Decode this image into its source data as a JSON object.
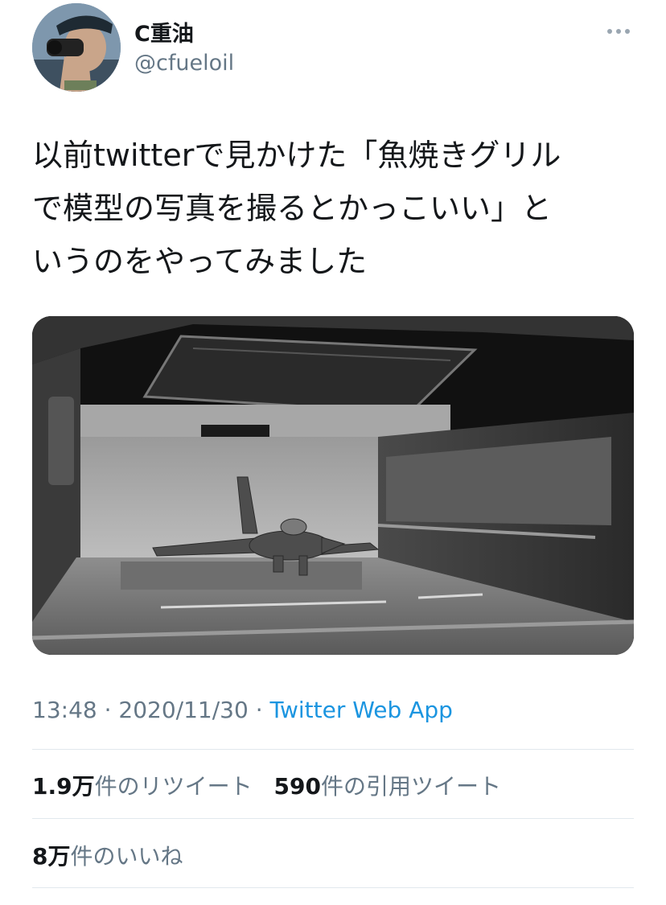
{
  "author": {
    "display_name": "C重油",
    "handle": "@cfueloil",
    "avatar_icon": "avatar-photo"
  },
  "more_icon": "more-dots-icon",
  "tweet": {
    "text_lines": [
      "以前twitterで見かけた「魚焼きグリル",
      "で模型の写真を撮るとかっこいい」と",
      "いうのをやってみました"
    ]
  },
  "media": {
    "description_icon": "photo-model-jet-in-fish-grill"
  },
  "meta": {
    "time": "13:48",
    "separator": " · ",
    "date": "2020/11/30",
    "source": "Twitter Web App"
  },
  "stats": {
    "retweets_value": "1.9万",
    "retweets_label": "件のリツイート",
    "quotes_value": "590",
    "quotes_label": "件の引用ツイート",
    "likes_value": "8万",
    "likes_label": "件のいいね"
  },
  "colors": {
    "link": "#1b95e0",
    "secondary_text": "#657786",
    "primary_text": "#14171a",
    "divider": "#e1e8ed"
  }
}
